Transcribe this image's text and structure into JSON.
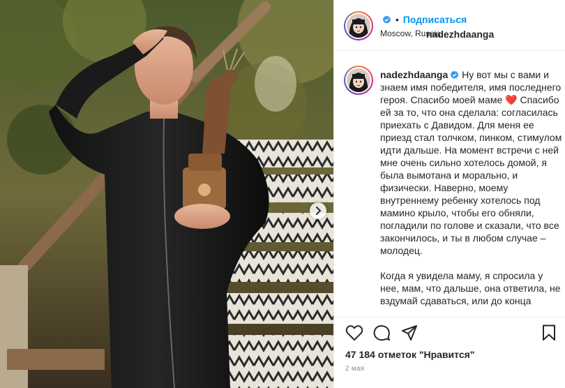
{
  "post": {
    "username": "nadezhdaanga",
    "follow_label": "Подписаться",
    "location": "Moscow, Russia",
    "caption_p1": "Ну вот мы с вами и знаем имя победителя, имя последнего героя. Спасибо моей маме",
    "caption_heart": "❤️",
    "caption_p1b": " Спасибо ей за то, что она сделала: согласилась приехать с Давидом. Для меня ее приезд стал толчком, пинком, стимулом идти дальше. На момент встречи с ней мне очень сильно хотелось домой, я была вымотана и морально, и физически. Наверно, моему внутреннему ребенку хотелось под мамино крыло, чтобы его обняли, погладили по голове и сказали, что все закончилось, и ты в любом случае – молодец.",
    "caption_p2": "Когда я увидела маму, я спросила у нее, мам, что дальше, она ответила, не вздумай сдаваться, или до конца",
    "likes_text": "47 184 отметок \"Нравится\"",
    "date": "2 мая"
  },
  "icons": {
    "like": "heart-outline-icon",
    "comment": "comment-bubble-icon",
    "share": "paper-plane-icon",
    "save": "bookmark-icon",
    "verified": "verified-badge-icon",
    "next": "chevron-right-icon"
  },
  "colors": {
    "accent": "#0095f6",
    "verified": "#3897f0",
    "muted": "#8e8e8e",
    "text": "#262626"
  }
}
